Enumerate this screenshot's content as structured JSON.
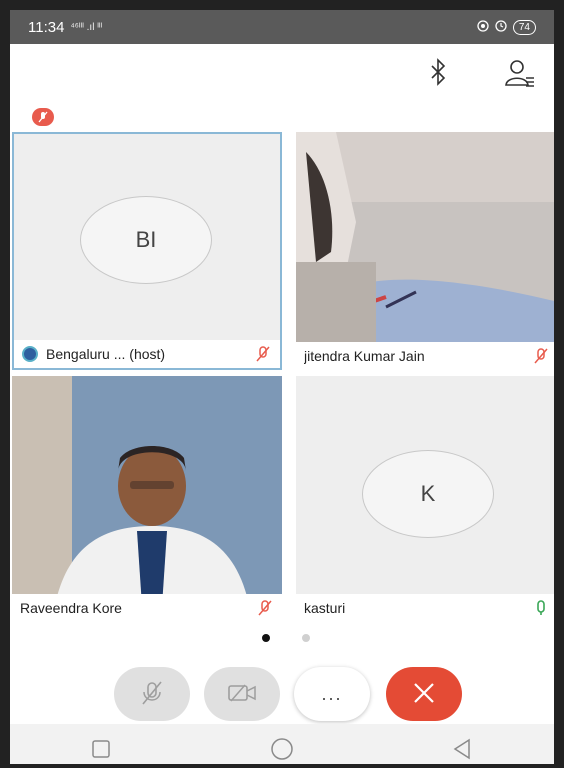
{
  "status_bar": {
    "time": "11:34",
    "signal_text": "⁴⁶ᴵᴵᴵ .ıl ᴵᴵᴵ",
    "battery": "74",
    "icons": [
      "alarm-icon",
      "clock-icon",
      "battery-icon"
    ]
  },
  "toolbar": {
    "icons": [
      "bluetooth-icon",
      "participants-icon"
    ]
  },
  "tiles": [
    {
      "id": "bl",
      "initials": "BI",
      "name": "Bengaluru ... (host)",
      "is_host": true,
      "mic": "muted",
      "has_video": false
    },
    {
      "id": "jk",
      "initials": "",
      "name": "jitendra Kumar Jain",
      "is_host": false,
      "mic": "muted",
      "has_video": true
    },
    {
      "id": "rk",
      "initials": "",
      "name": "Raveendra Kore",
      "is_host": false,
      "mic": "muted",
      "has_video": true
    },
    {
      "id": "ks",
      "initials": "K",
      "name": "kasturi",
      "is_host": false,
      "mic": "on",
      "has_video": false
    }
  ],
  "pagination": {
    "current": 1,
    "total": 2
  },
  "controls": [
    {
      "id": "mute",
      "icon": "mic-off-icon"
    },
    {
      "id": "video",
      "icon": "video-off-icon"
    },
    {
      "id": "more",
      "icon": "more-icon",
      "label": "..."
    },
    {
      "id": "leave",
      "icon": "close-icon"
    }
  ],
  "colors": {
    "muted_red": "#e85b4d",
    "mic_on_green": "#3aa757",
    "leave_red": "#e44b35",
    "control_gray": "#e0e0e0"
  }
}
